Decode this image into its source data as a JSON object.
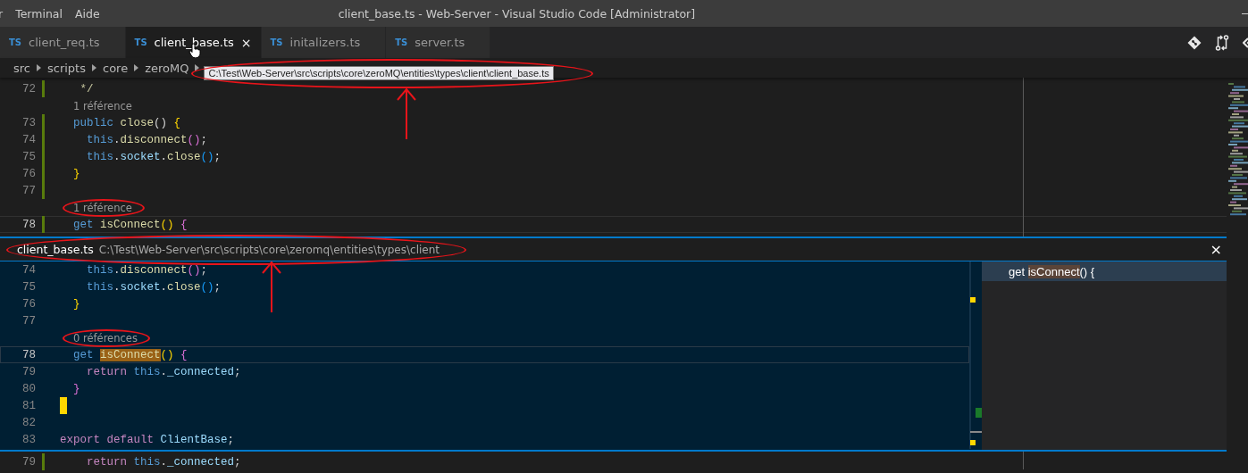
{
  "title_bar": {
    "menu": [
      "r",
      "Terminal",
      "Aide"
    ],
    "title": "client_base.ts - Web-Server - Visual Studio Code [Administrator]"
  },
  "tabs": [
    {
      "badge": "TS",
      "label": "client_req.ts",
      "selected": false,
      "hovered": false
    },
    {
      "badge": "TS",
      "label": "client_base.ts",
      "selected": true,
      "hovered": true,
      "close": "×"
    },
    {
      "badge": "TS",
      "label": "initalizers.ts",
      "selected": false,
      "hovered": false
    },
    {
      "badge": "TS",
      "label": "server.ts",
      "selected": false,
      "hovered": false
    }
  ],
  "breadcrumb": [
    "src",
    "scripts",
    "core",
    "zeroMQ"
  ],
  "tooltip": {
    "text": "C:\\Test\\Web-Server\\src\\scripts\\core\\zeroMQ\\entities\\types\\client\\client_base.ts",
    "circled": true,
    "arrow": true
  },
  "editor": {
    "lines": [
      {
        "kind": "code",
        "number": "72",
        "modified": true,
        "current": false,
        "tokens": [
          {
            "t": "   */",
            "kind": "cmt"
          }
        ]
      },
      {
        "kind": "lens",
        "text": "1 référence",
        "circled": false
      },
      {
        "kind": "code",
        "number": "73",
        "modified": true,
        "current": false,
        "tokens": [
          {
            "t": "  public ",
            "kind": "kw"
          },
          {
            "t": "close",
            "kind": "fn"
          },
          {
            "t": "() ",
            "kind": "punc"
          },
          {
            "t": "{",
            "kind": "br1"
          }
        ]
      },
      {
        "kind": "code",
        "number": "74",
        "modified": true,
        "current": false,
        "tokens": [
          {
            "t": "    this",
            "kind": "kw"
          },
          {
            "t": "."
          },
          {
            "t": "disconnect",
            "kind": "fn"
          },
          {
            "t": "()",
            "kind": "br2"
          },
          {
            "t": ";"
          }
        ]
      },
      {
        "kind": "code",
        "number": "75",
        "modified": true,
        "current": false,
        "tokens": [
          {
            "t": "    this",
            "kind": "kw"
          },
          {
            "t": "."
          },
          {
            "t": "socket",
            "kind": "prop"
          },
          {
            "t": "."
          },
          {
            "t": "close",
            "kind": "fn"
          },
          {
            "t": "()",
            "kind": "br3"
          },
          {
            "t": ";"
          }
        ]
      },
      {
        "kind": "code",
        "number": "76",
        "modified": true,
        "current": false,
        "tokens": [
          {
            "t": "  }",
            "kind": "br1"
          }
        ]
      },
      {
        "kind": "code",
        "number": "77",
        "modified": true,
        "current": false
      },
      {
        "kind": "lens",
        "text": "1 référence",
        "circled": true
      },
      {
        "kind": "code",
        "number": "78",
        "modified": true,
        "current": true,
        "tokens": [
          {
            "t": "  get ",
            "kind": "kw"
          },
          {
            "t": "isConnect",
            "kind": "fn"
          },
          {
            "t": "() ",
            "kind": "br1"
          },
          {
            "t": "{",
            "kind": "br2"
          }
        ]
      }
    ]
  },
  "peek": {
    "file": "client_base.ts",
    "path": "C:\\Test\\Web-Server\\src\\scripts\\core\\zeromq\\entities\\types\\client",
    "circled": true,
    "arrow": true,
    "close": "×",
    "lines": [
      {
        "kind": "code",
        "number": "74",
        "current": false,
        "marker": false,
        "tokens": [
          {
            "t": "    this",
            "kind": "kw"
          },
          {
            "t": "."
          },
          {
            "t": "disconnect",
            "kind": "fn"
          },
          {
            "t": "()",
            "kind": "br2"
          },
          {
            "t": ";"
          }
        ]
      },
      {
        "kind": "code",
        "number": "75",
        "current": false,
        "marker": false,
        "tokens": [
          {
            "t": "    this",
            "kind": "kw"
          },
          {
            "t": "."
          },
          {
            "t": "socket",
            "kind": "prop"
          },
          {
            "t": "."
          },
          {
            "t": "close",
            "kind": "fn"
          },
          {
            "t": "()",
            "kind": "br3"
          },
          {
            "t": ";"
          }
        ]
      },
      {
        "kind": "code",
        "number": "76",
        "current": false,
        "marker": false,
        "tokens": [
          {
            "t": "  }",
            "kind": "br1"
          }
        ]
      },
      {
        "kind": "code",
        "number": "77",
        "current": false,
        "marker": false
      },
      {
        "kind": "lens",
        "text": "0 références",
        "circled": true
      },
      {
        "kind": "code",
        "number": "78",
        "current": true,
        "marker": false,
        "tokens": [
          {
            "t": "  get ",
            "kind": "kw"
          },
          {
            "t": "isConnect",
            "kind": "fn",
            "match": true
          },
          {
            "t": "() ",
            "kind": "br1"
          },
          {
            "t": "{",
            "kind": "br2"
          }
        ]
      },
      {
        "kind": "code",
        "number": "79",
        "current": false,
        "marker": false,
        "tokens": [
          {
            "t": "    return ",
            "kind": "ctl"
          },
          {
            "t": "this",
            "kind": "kw"
          },
          {
            "t": "."
          },
          {
            "t": "_connected",
            "kind": "prop"
          },
          {
            "t": ";"
          }
        ]
      },
      {
        "kind": "code",
        "number": "80",
        "current": false,
        "marker": false,
        "tokens": [
          {
            "t": "  }",
            "kind": "br2"
          }
        ]
      },
      {
        "kind": "code",
        "number": "81",
        "current": false,
        "marker": true
      },
      {
        "kind": "code",
        "number": "82",
        "current": false,
        "marker": false
      },
      {
        "kind": "code",
        "number": "83",
        "current": false,
        "marker": false,
        "tokens": [
          {
            "t": "export default ",
            "kind": "ctl"
          },
          {
            "t": "ClientBase",
            "kind": "prop"
          },
          {
            "t": ";"
          }
        ]
      }
    ],
    "references": [
      {
        "before": "get ",
        "match": "isConnect",
        "after": "() {",
        "selected": true
      }
    ]
  },
  "bottom_editor": {
    "lines": [
      {
        "kind": "code",
        "number": "79",
        "modified": true,
        "current": false,
        "tokens": [
          {
            "t": "    return ",
            "kind": "ctl"
          },
          {
            "t": "this",
            "kind": "kw"
          },
          {
            "t": "."
          },
          {
            "t": "_connected",
            "kind": "prop"
          },
          {
            "t": ";"
          }
        ]
      }
    ]
  }
}
